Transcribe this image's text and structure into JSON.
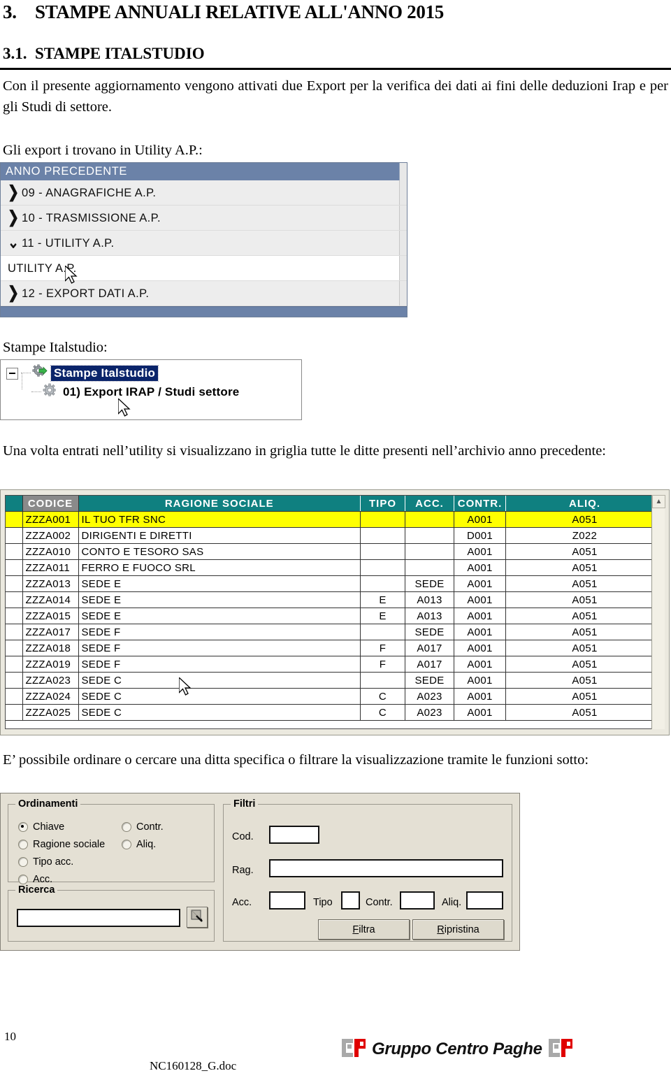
{
  "doc": {
    "h1_number": "3.",
    "h1_title": "STAMPE ANNUALI RELATIVE ALL'ANNO 2015",
    "h2_number": "3.1.",
    "h2_title": "STAMPE ITALSTUDIO",
    "para1": "Con il presente aggiornamento vengono attivati due Export per la verifica dei dati ai fini delle deduzioni Irap e per gli Studi di settore.",
    "para2": "Gli export i trovano in Utility A.P.:",
    "para3": "Stampe Italstudio:",
    "para4": "Una volta entrati nell’utility si visualizzano in griglia tutte le ditte presenti nell’archivio anno precedente:",
    "para5": "E’ possibile ordinare o cercare una ditta specifica o filtrare la visualizzazione tramite le funzioni sotto:"
  },
  "menu": {
    "title": "ANNO PRECEDENTE",
    "items": [
      {
        "label": "09 - ANAGRAFICHE A.P.",
        "chevron": "❯",
        "style": "alt"
      },
      {
        "label": "10 - TRASMISSIONE A.P.",
        "chevron": "❯",
        "style": "alt"
      },
      {
        "label": "11 - UTILITY A.P.",
        "chevron": "⌄",
        "style": "alt"
      },
      {
        "label": "UTILITY A.P.",
        "chevron": "",
        "style": "plain"
      },
      {
        "label": "12 - EXPORT DATI A.P.",
        "chevron": "❯",
        "style": "alt"
      }
    ]
  },
  "tree": {
    "root_label": "Stampe Italstudio",
    "child_label": "01) Export IRAP / Studi settore",
    "root_icon": "gear-green-arrow-icon",
    "child_icon": "gear-icon",
    "expander": "minus-box-icon"
  },
  "grid": {
    "columns": [
      "CODICE",
      "RAGIONE SOCIALE",
      "TIPO",
      "ACC.",
      "CONTR.",
      "ALIQ."
    ],
    "highlight_color": "#ffff00",
    "header_color": "#0f8080",
    "rows": [
      {
        "codice": "ZZZA001",
        "ragione": "IL TUO TFR SNC",
        "tipo": "",
        "acc": "",
        "contr": "A001",
        "aliq": "A051",
        "selected": true
      },
      {
        "codice": "ZZZA002",
        "ragione": "DIRIGENTI E DIRETTI",
        "tipo": "",
        "acc": "",
        "contr": "D001",
        "aliq": "Z022",
        "selected": false
      },
      {
        "codice": "ZZZA010",
        "ragione": "CONTO E TESORO SAS",
        "tipo": "",
        "acc": "",
        "contr": "A001",
        "aliq": "A051",
        "selected": false
      },
      {
        "codice": "ZZZA011",
        "ragione": "FERRO E FUOCO SRL",
        "tipo": "",
        "acc": "",
        "contr": "A001",
        "aliq": "A051",
        "selected": false
      },
      {
        "codice": "ZZZA013",
        "ragione": "SEDE E",
        "tipo": "",
        "acc": "SEDE",
        "contr": "A001",
        "aliq": "A051",
        "selected": false
      },
      {
        "codice": "ZZZA014",
        "ragione": "SEDE E",
        "tipo": "E",
        "acc": "A013",
        "contr": "A001",
        "aliq": "A051",
        "selected": false
      },
      {
        "codice": "ZZZA015",
        "ragione": "SEDE E",
        "tipo": "E",
        "acc": "A013",
        "contr": "A001",
        "aliq": "A051",
        "selected": false
      },
      {
        "codice": "ZZZA017",
        "ragione": "SEDE F",
        "tipo": "",
        "acc": "SEDE",
        "contr": "A001",
        "aliq": "A051",
        "selected": false
      },
      {
        "codice": "ZZZA018",
        "ragione": "SEDE F",
        "tipo": "F",
        "acc": "A017",
        "contr": "A001",
        "aliq": "A051",
        "selected": false
      },
      {
        "codice": "ZZZA019",
        "ragione": "SEDE F",
        "tipo": "F",
        "acc": "A017",
        "contr": "A001",
        "aliq": "A051",
        "selected": false
      },
      {
        "codice": "ZZZA023",
        "ragione": "SEDE C",
        "tipo": "",
        "acc": "SEDE",
        "contr": "A001",
        "aliq": "A051",
        "selected": false
      },
      {
        "codice": "ZZZA024",
        "ragione": "SEDE C",
        "tipo": "C",
        "acc": "A023",
        "contr": "A001",
        "aliq": "A051",
        "selected": false
      },
      {
        "codice": "ZZZA025",
        "ragione": "SEDE C",
        "tipo": "C",
        "acc": "A023",
        "contr": "A001",
        "aliq": "A051",
        "selected": false
      }
    ]
  },
  "form": {
    "ordinamenti": {
      "title": "Ordinamenti",
      "options": [
        {
          "label": "Chiave",
          "checked": true
        },
        {
          "label": "Ragione sociale",
          "checked": false
        },
        {
          "label": "Tipo acc.",
          "checked": false
        },
        {
          "label": "Acc.",
          "checked": false
        },
        {
          "label": "Contr.",
          "checked": false
        },
        {
          "label": "Aliq.",
          "checked": false
        }
      ]
    },
    "ricerca": {
      "title": "Ricerca",
      "value": "",
      "button_icon": "search-icon"
    },
    "filtri": {
      "title": "Filtri",
      "cod_label": "Cod.",
      "cod_value": "",
      "rag_label": "Rag.",
      "rag_value": "",
      "acc_label": "Acc.",
      "acc_value": "",
      "tipo_label": "Tipo",
      "tipo_value": "",
      "contr_label": "Contr.",
      "contr_value": "",
      "aliq_label": "Aliq.",
      "aliq_value": "",
      "filtra_mnemonic": "F",
      "filtra_rest": "iltra",
      "ripristina_mnemonic": "R",
      "ripristina_rest": "ipristina"
    }
  },
  "footer": {
    "page_number": "10",
    "doc_name": "NC160128_G.doc",
    "logo_text": "Gruppo Centro Paghe",
    "logo_gray": "#a9a9a9",
    "logo_red": "#e00000"
  }
}
